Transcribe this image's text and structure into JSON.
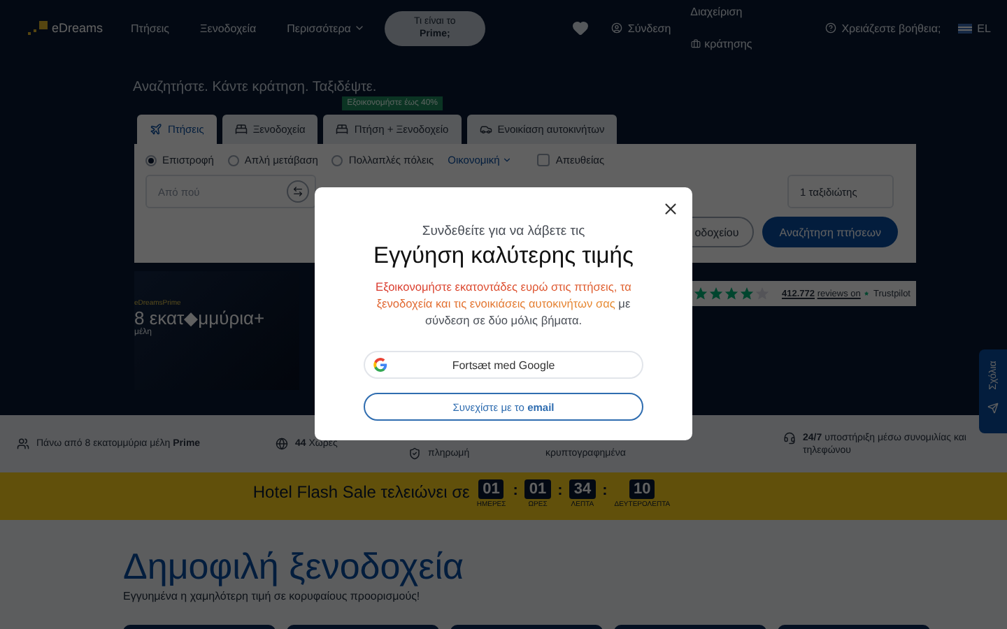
{
  "header": {
    "logo": "eDreams",
    "nav": [
      {
        "label": "Πτήσεις",
        "dropdown": false
      },
      {
        "label": "Ξενοδοχεία",
        "dropdown": false
      },
      {
        "label": "Περισσότερα",
        "dropdown": true
      }
    ],
    "prime_button": {
      "line1": "Τι είναι το",
      "line2": "Prime;"
    },
    "login": "Σύνδεση",
    "manage": {
      "line1": "Διαχείριση",
      "line2": "κράτησης"
    },
    "help": "Χρειάζεστε βοήθεια;",
    "language": "EL"
  },
  "hero": {
    "title": "Αναζητήστε. Κάντε κράτηση. Ταξιδέψτε.",
    "tabs": [
      {
        "label": "Πτήσεις",
        "kind": "plane",
        "selected": true
      },
      {
        "label": "Ξενοδοχεία",
        "kind": "bed",
        "selected": false
      },
      {
        "label": "Πτήση + Ξενοδοχείο",
        "kind": "combo",
        "selected": false,
        "badge": "Εξοικονομήστε έως 40%"
      },
      {
        "label": "Ενοικίαση αυτοκινήτων",
        "kind": "car",
        "selected": false
      }
    ],
    "trip_types": [
      {
        "label": "Επιστροφή",
        "selected": true
      },
      {
        "label": "Απλή μετάβαση",
        "selected": false
      },
      {
        "label": "Πολλαπλές πόλεις",
        "selected": false
      }
    ],
    "cabin": "Οικονομική",
    "direct": {
      "label": "Απευθείας",
      "checked": false
    },
    "origin": {
      "placeholder": "Από πού"
    },
    "travellers": "1 ταξιδιώτης",
    "secondary_button": "οδοχείου",
    "search_button": "Αναζήτηση πτήσεων",
    "prime_promo": {
      "logo": "eDreamsPrime",
      "headline": "8 εκατ◆μμύρια+",
      "caption": "μέλη"
    },
    "trustpilot": {
      "stars": 4,
      "reviews": "412.772",
      "reviews_text": "reviews on",
      "brand": "Trustpilot"
    }
  },
  "feedback_tab": "Σχόλια",
  "features": [
    {
      "kind": "people",
      "text": "Πάνω από 8 εκατομμύρια μέλη **Prime**"
    },
    {
      "kind": "globe",
      "text": "**44** Χώρες"
    },
    {
      "kind": "shield",
      "text": "πληρωμή"
    },
    {
      "kind": "none",
      "text": "κρυπτογραφημένα"
    },
    {
      "kind": "headset",
      "text": "**24/7** υποστήριξη μέσω συνομιλίας και τηλεφώνου"
    }
  ],
  "flash_sale": {
    "title": "Hotel Flash Sale τελειώνει σε",
    "units": [
      {
        "value": "01",
        "label": "ΗΜΕΡΕΣ"
      },
      {
        "value": "01",
        "label": "ΩΡΕΣ"
      },
      {
        "value": "34",
        "label": "ΛΕΠΤΑ"
      },
      {
        "value": "10",
        "label": "ΔΕΥΤΕΡΟΛΕΠΤΑ"
      }
    ],
    "separators": [
      ":",
      ":",
      ":"
    ]
  },
  "popular": {
    "title": "Δημοφιλή ξενοδοχεία",
    "subtitle": "Εγγυημένα η χαμηλότερη τιμή σε κορυφαίους προορισμούς!"
  },
  "modal": {
    "intro": "Συνδεθείτε για να λάβετε τις",
    "title": "Εγγύηση καλύτερης τιμής",
    "highlight": "Εξοικονομήστε εκατοντάδες ευρώ στις πτήσεις, τα ξενοδοχεία και τις ενοικιάσεις αυτοκινήτων σας",
    "rest": " με σύνδεση σε δύο μόλις βήματα.",
    "google_button": "Fortsæt med Google",
    "email_button": "Συνεχίστε με το **email**"
  }
}
